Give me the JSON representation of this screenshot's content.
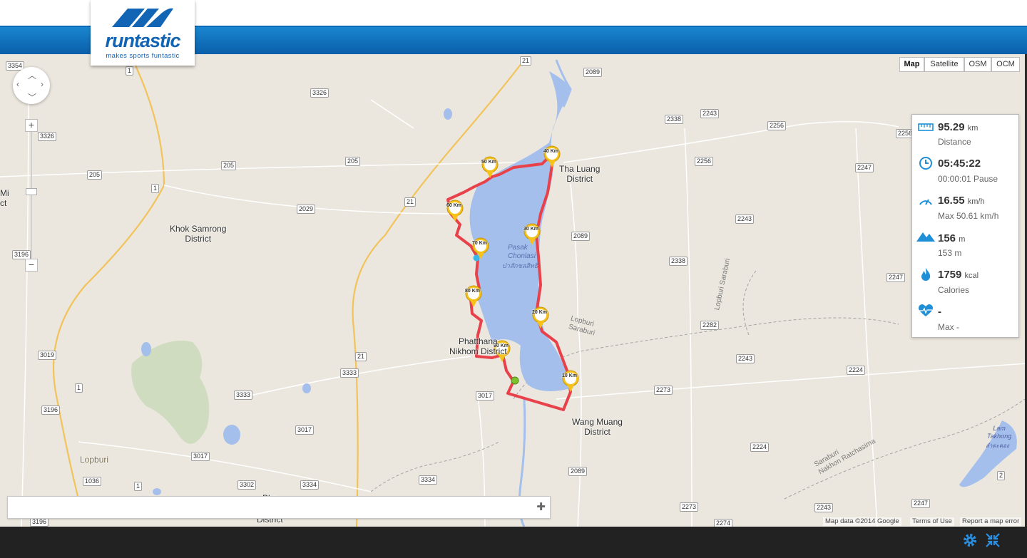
{
  "app": {
    "logo_text": "runtastic",
    "logo_tagline": "makes sports funtastic"
  },
  "map_types": [
    {
      "label": "Map",
      "active": true
    },
    {
      "label": "Satellite",
      "active": false
    },
    {
      "label": "OSM",
      "active": false
    },
    {
      "label": "OCM",
      "active": false
    }
  ],
  "zoom": {
    "plus": "+",
    "minus": "−"
  },
  "places": {
    "tha_luang": "Tha Luang\nDistrict",
    "khok_samrong": "Khok Samrong\nDistrict",
    "phatthana": "Phatthana\nNikhom District",
    "wang_muang": "Wang Muang\nDistrict",
    "lopburi": "Lopburi",
    "pha": "Pha",
    "district_bottom": "District",
    "mi": "Mi",
    "ct": "ct",
    "lake_en": "Pasak\nChonlasi",
    "lake_th": "ป่าสักชลสิทธิ์",
    "lam_takhong": "Lam\nTakhong",
    "lam_takhong_th": "ลำตะคอง"
  },
  "boundaries": {
    "lopburi_saraburi_1": "Lopburi\nSaraburi",
    "lopburi_saraburi_2": "Lopburi Saraburi",
    "saraburi_nakhon": "Saraburi\nNakhon Ratchasima"
  },
  "roads": [
    "3354",
    "1",
    "21",
    "3326",
    "2089",
    "2338",
    "2243",
    "2256",
    "3326",
    "205",
    "205",
    "205",
    "2256",
    "2256",
    "2247",
    "1",
    "21",
    "2029",
    "2089",
    "2243",
    "3196",
    "2338",
    "2247",
    "2282",
    "3019",
    "21",
    "3333",
    "2243",
    "2224",
    "1",
    "3333",
    "3017",
    "2273",
    "3196",
    "3017",
    "2224",
    "3017",
    "3334",
    "2089",
    "1036",
    "3302",
    "3334",
    "2",
    "1",
    "2273",
    "2243",
    "2247",
    "3196",
    "2274",
    "2089"
  ],
  "markers": [
    "10\nKm",
    "20\nKm",
    "30\nKm",
    "40\nKm",
    "50\nKm",
    "60\nKm",
    "70\nKm",
    "80\nKm",
    "90\nKm"
  ],
  "stats": {
    "distance_value": "95.29",
    "distance_unit": "km",
    "distance_label": "Distance",
    "duration_value": "05:45:22",
    "pause_label": "00:00:01 Pause",
    "speed_value": "16.55",
    "speed_unit": "km/h",
    "speed_max": "Max 50.61 km/h",
    "elevation_value": "156",
    "elevation_unit": "m",
    "elevation_sub": "153 m",
    "calories_value": "1759",
    "calories_unit": "kcal",
    "calories_label": "Calories",
    "heart_value": "-",
    "heart_max": "Max -"
  },
  "attribution": {
    "map_data": "Map data ©2014 Google",
    "terms": "Terms of Use",
    "report": "Report a map error"
  },
  "colors": {
    "brand_blue": "#0b6ab8",
    "route_red": "#e8414a",
    "lake_blue": "#a5bfec",
    "marker_yellow": "#f6c21a"
  },
  "icons": [
    "settings-gear-icon",
    "fullscreen-collapse-icon"
  ]
}
